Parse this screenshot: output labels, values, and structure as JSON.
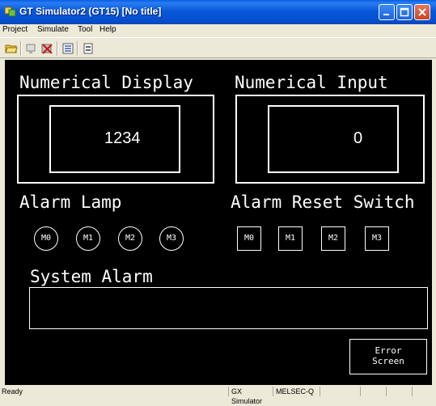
{
  "window": {
    "title": "GT Simulator2 (GT15)  [No title]"
  },
  "menu": [
    "Project",
    "Simulate",
    "Tool",
    "Help"
  ],
  "toolbar": {
    "icons": [
      "open-folder-icon",
      "monitor-icon",
      "device-stop-icon",
      "list-icon",
      "properties-icon"
    ]
  },
  "screen": {
    "numerical_display": {
      "label": "Numerical Display",
      "value": "1234"
    },
    "numerical_input": {
      "label": "Numerical Input",
      "value": "0"
    },
    "alarm_lamp": {
      "label": "Alarm Lamp",
      "lamps": [
        "M0",
        "M1",
        "M2",
        "M3"
      ]
    },
    "alarm_reset": {
      "label": "Alarm Reset Switch",
      "switches": [
        "M0",
        "M1",
        "M2",
        "M3"
      ]
    },
    "system_alarm": {
      "label": "System Alarm",
      "text": ""
    },
    "error_screen": {
      "line1": "Error",
      "line2": "Screen"
    }
  },
  "statusbar": {
    "status": "Ready",
    "simulator": "GX Simulator",
    "plc": "MELSEC-Q"
  },
  "colors": {
    "titlebar": "#0858d8",
    "screen_bg": "#000000",
    "screen_fg": "#ffffff",
    "chrome": "#ece9d8"
  }
}
